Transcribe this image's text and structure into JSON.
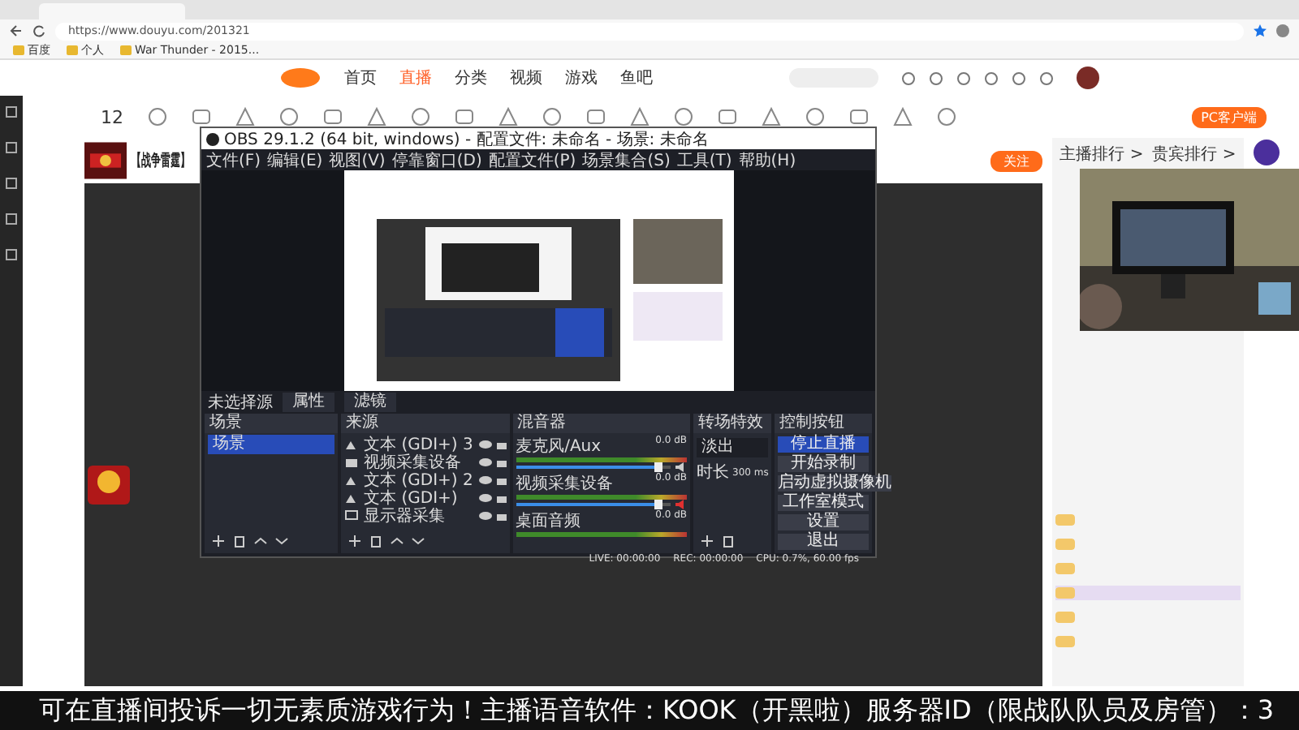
{
  "browser": {
    "url": "https://www.douyu.com/201321",
    "bookmarks": [
      "百度",
      "个人",
      "War Thunder - 2015..."
    ]
  },
  "site": {
    "nav": [
      {
        "label": "首页",
        "selected": false
      },
      {
        "label": "直播",
        "selected": true
      },
      {
        "label": "分类",
        "selected": false
      },
      {
        "label": "视频",
        "selected": false
      },
      {
        "label": "游戏",
        "selected": false
      },
      {
        "label": "鱼吧",
        "selected": false
      }
    ],
    "follow_count": "12",
    "client_button": "PC客户端"
  },
  "room": {
    "title": "【战争雷霆】",
    "follow_button": "关注",
    "rank_tabs": [
      "主播排行 >",
      "贵宾排行 >"
    ]
  },
  "obs": {
    "title": "OBS 29.1.2 (64 bit, windows) - 配置文件: 未命名 - 场景: 未命名",
    "menu": [
      "文件(F)",
      "编辑(E)",
      "视图(V)",
      "停靠窗口(D)",
      "配置文件(P)",
      "场景集合(S)",
      "工具(T)",
      "帮助(H)"
    ],
    "preview_bar": {
      "label": "未选择源",
      "buttons": [
        "属性",
        "滤镜"
      ]
    },
    "docks": [
      "场景",
      "来源",
      "混音器",
      "转场特效",
      "控制按钮"
    ],
    "scenes": [
      {
        "label": "场景",
        "selected": true
      }
    ],
    "sources": [
      {
        "label": "文本 (GDI+) 3",
        "kind": "text"
      },
      {
        "label": "视频采集设备",
        "kind": "camera"
      },
      {
        "label": "文本 (GDI+) 2",
        "kind": "text"
      },
      {
        "label": "文本 (GDI+)",
        "kind": "text"
      },
      {
        "label": "显示器采集",
        "kind": "monitor"
      }
    ],
    "mixer": [
      {
        "name": "麦克风/Aux",
        "reading": "0.0 dB",
        "muted": false,
        "level": 0.93
      },
      {
        "name": "视频采集设备",
        "reading": "0.0 dB",
        "muted": true,
        "level": 0.93
      },
      {
        "name": "桌面音频",
        "reading": "0.0 dB"
      }
    ],
    "transition": {
      "value": "淡出",
      "duration_label": "时长",
      "duration": "300 ms"
    },
    "controls": [
      {
        "label": "停止直播",
        "kind": "primary"
      },
      {
        "label": "开始录制",
        "kind": "normal"
      },
      {
        "label": "启动虚拟摄像机",
        "kind": "gear"
      },
      {
        "label": "工作室模式",
        "kind": "normal"
      },
      {
        "label": "设置",
        "kind": "normal"
      },
      {
        "label": "退出",
        "kind": "normal"
      }
    ],
    "status": [
      "LIVE: 00:00:00",
      "REC: 00:00:00",
      "CPU: 0.7%, 60.00 fps"
    ]
  },
  "ticker": "可在直播间投诉一切无素质游戏行为！主播语音软件：KOOK（开黑啦）服务器ID（限战队队员及房管）：3"
}
